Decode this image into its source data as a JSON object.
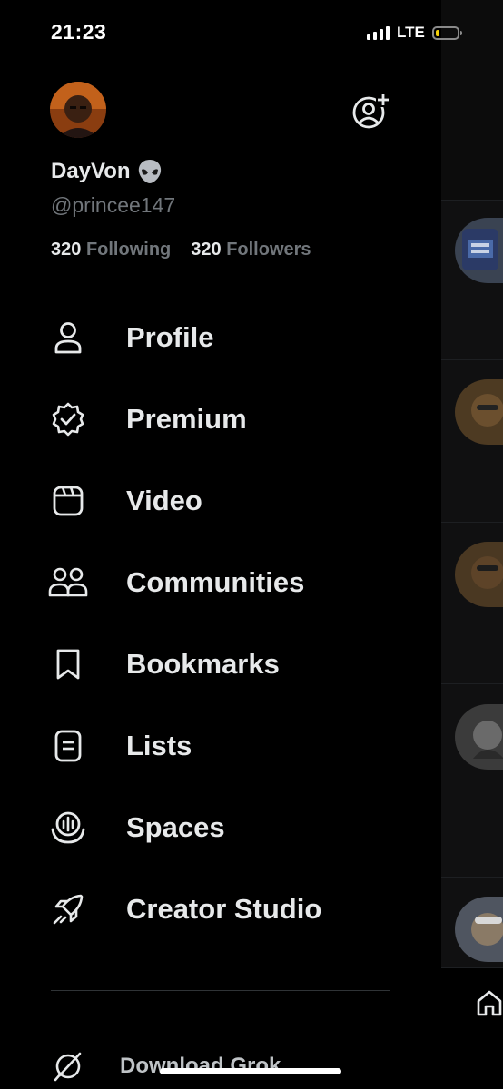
{
  "status_bar": {
    "time": "21:23",
    "network": "LTE",
    "battery_level": 0.2,
    "battery_color": "#f5d10a"
  },
  "profile": {
    "display_name": "DayVon",
    "name_emoji": "alien-emoji",
    "handle": "@princee147",
    "following_count": "320",
    "following_label": "Following",
    "followers_count": "320",
    "followers_label": "Followers"
  },
  "menu": {
    "items": [
      {
        "label": "Profile",
        "icon": "person-icon"
      },
      {
        "label": "Premium",
        "icon": "verified-badge-icon"
      },
      {
        "label": "Video",
        "icon": "video-icon"
      },
      {
        "label": "Communities",
        "icon": "communities-icon"
      },
      {
        "label": "Bookmarks",
        "icon": "bookmark-icon"
      },
      {
        "label": "Lists",
        "icon": "list-icon"
      },
      {
        "label": "Spaces",
        "icon": "spaces-icon"
      },
      {
        "label": "Creator Studio",
        "icon": "rocket-icon"
      }
    ],
    "download_grok": {
      "label": "Download Grok",
      "icon": "grok-icon"
    }
  },
  "colors": {
    "background": "#000000",
    "primary_text": "#e7e9ea",
    "secondary_text": "#71767b"
  }
}
